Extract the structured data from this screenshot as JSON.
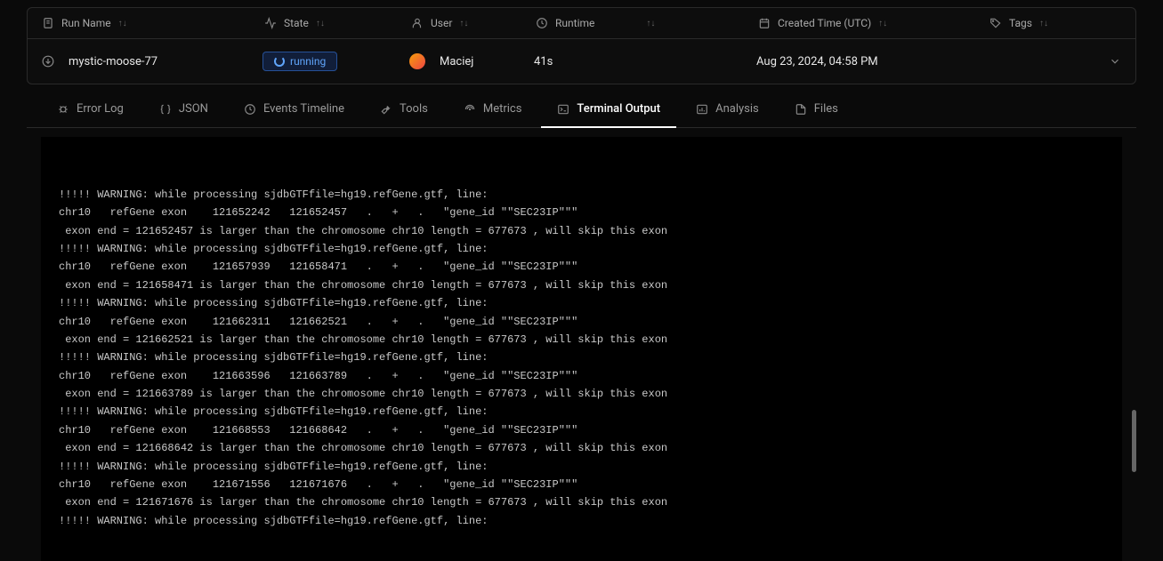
{
  "header": {
    "runName": "Run Name",
    "state": "State",
    "user": "User",
    "runtime": "Runtime",
    "createdTime": "Created Time (UTC)",
    "tags": "Tags"
  },
  "row": {
    "name": "mystic-moose-77",
    "state": "running",
    "user": "Maciej",
    "runtime": "41s",
    "createdTime": "Aug 23, 2024, 04:58 PM"
  },
  "tabs": {
    "errorLog": "Error Log",
    "json": "JSON",
    "eventsTimeline": "Events Timeline",
    "tools": "Tools",
    "metrics": "Metrics",
    "terminalOutput": "Terminal Output",
    "analysis": "Analysis",
    "files": "Files"
  },
  "terminal": [
    "!!!!! WARNING: while processing sjdbGTFfile=hg19.refGene.gtf, line:",
    "chr10   refGene exon    121652242   121652457   .   +   .   \"gene_id \"\"SEC23IP\"\"\"",
    " exon end = 121652457 is larger than the chromosome chr10 length = 677673 , will skip this exon",
    "!!!!! WARNING: while processing sjdbGTFfile=hg19.refGene.gtf, line:",
    "chr10   refGene exon    121657939   121658471   .   +   .   \"gene_id \"\"SEC23IP\"\"\"",
    " exon end = 121658471 is larger than the chromosome chr10 length = 677673 , will skip this exon",
    "!!!!! WARNING: while processing sjdbGTFfile=hg19.refGene.gtf, line:",
    "chr10   refGene exon    121662311   121662521   .   +   .   \"gene_id \"\"SEC23IP\"\"\"",
    " exon end = 121662521 is larger than the chromosome chr10 length = 677673 , will skip this exon",
    "!!!!! WARNING: while processing sjdbGTFfile=hg19.refGene.gtf, line:",
    "chr10   refGene exon    121663596   121663789   .   +   .   \"gene_id \"\"SEC23IP\"\"\"",
    " exon end = 121663789 is larger than the chromosome chr10 length = 677673 , will skip this exon",
    "!!!!! WARNING: while processing sjdbGTFfile=hg19.refGene.gtf, line:",
    "chr10   refGene exon    121668553   121668642   .   +   .   \"gene_id \"\"SEC23IP\"\"\"",
    " exon end = 121668642 is larger than the chromosome chr10 length = 677673 , will skip this exon",
    "!!!!! WARNING: while processing sjdbGTFfile=hg19.refGene.gtf, line:",
    "chr10   refGene exon    121671556   121671676   .   +   .   \"gene_id \"\"SEC23IP\"\"\"",
    " exon end = 121671676 is larger than the chromosome chr10 length = 677673 , will skip this exon",
    "!!!!! WARNING: while processing sjdbGTFfile=hg19.refGene.gtf, line:"
  ]
}
